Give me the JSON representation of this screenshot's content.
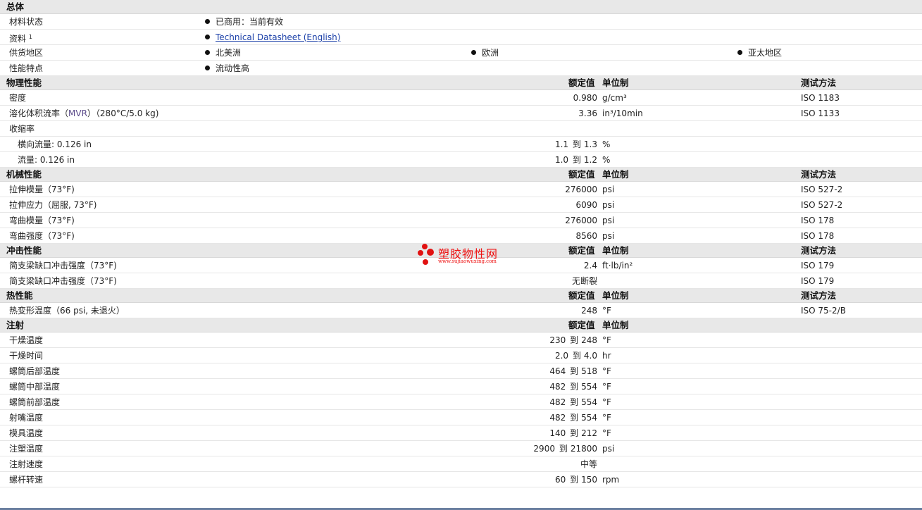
{
  "general": {
    "title": "总体",
    "rows": [
      {
        "label": "材料状态",
        "items": [
          "已商用：当前有效"
        ]
      },
      {
        "label": "资料",
        "sup": "1",
        "items": [
          "Technical Datasheet (English)"
        ],
        "link": true
      },
      {
        "label": "供货地区",
        "items": [
          "北美洲",
          "欧洲",
          "亚太地区"
        ]
      },
      {
        "label": "性能特点",
        "items": [
          "流动性高"
        ]
      }
    ]
  },
  "headers": {
    "value": "额定值",
    "unit": "单位制",
    "method": "测试方法"
  },
  "physical": {
    "title": "物理性能",
    "rows": [
      {
        "label": "密度",
        "value": "0.980",
        "unit": "g/cm³",
        "method": "ISO 1183"
      },
      {
        "label_pre": "溶化体积流率（",
        "label_mvr": "MVR",
        "label_post": "）（280°C/5.0 kg)",
        "value": "3.36",
        "unit": "in³/10min",
        "method": "ISO 1133"
      },
      {
        "label": "收缩率",
        "value": "",
        "unit": "",
        "method": ""
      },
      {
        "label": "横向流量: 0.126 in",
        "sub": true,
        "from": "1.1",
        "to": "1.3",
        "unit": "%",
        "method": ""
      },
      {
        "label": "流量: 0.126 in",
        "sub": true,
        "from": "1.0",
        "to": "1.2",
        "unit": "%",
        "method": ""
      }
    ]
  },
  "mechanical": {
    "title": "机械性能",
    "rows": [
      {
        "label": "拉伸模量（73°F)",
        "value": "276000",
        "unit": "psi",
        "method": "ISO 527-2"
      },
      {
        "label": "拉伸应力（屈服, 73°F)",
        "value": "6090",
        "unit": "psi",
        "method": "ISO 527-2"
      },
      {
        "label": "弯曲模量（73°F)",
        "value": "276000",
        "unit": "psi",
        "method": "ISO 178"
      },
      {
        "label": "弯曲强度（73°F)",
        "value": "8560",
        "unit": "psi",
        "method": "ISO 178"
      }
    ]
  },
  "impact": {
    "title": "冲击性能",
    "rows": [
      {
        "label": "简支梁缺口冲击强度（73°F)",
        "value": "2.4",
        "unit": "ft·lb/in²",
        "method": "ISO 179"
      },
      {
        "label": "简支梁缺口冲击强度（73°F)",
        "value": "无断裂",
        "unit": "",
        "method": "ISO 179"
      }
    ]
  },
  "thermal": {
    "title": "热性能",
    "rows": [
      {
        "label": "热变形温度（66 psi, 未退火）",
        "value": "248",
        "unit": "°F",
        "method": "ISO 75-2/B"
      }
    ]
  },
  "injection": {
    "title": "注射",
    "rows": [
      {
        "label": "干燥温度",
        "from": "230",
        "to": "248",
        "unit": "°F"
      },
      {
        "label": "干燥时间",
        "from": "2.0",
        "to": "4.0",
        "unit": "hr"
      },
      {
        "label": "螺筒后部温度",
        "from": "464",
        "to": "518",
        "unit": "°F"
      },
      {
        "label": "螺筒中部温度",
        "from": "482",
        "to": "554",
        "unit": "°F"
      },
      {
        "label": "螺筒前部温度",
        "from": "482",
        "to": "554",
        "unit": "°F"
      },
      {
        "label": "射嘴温度",
        "from": "482",
        "to": "554",
        "unit": "°F"
      },
      {
        "label": "模具温度",
        "from": "140",
        "to": "212",
        "unit": "°F"
      },
      {
        "label": "注塑温度",
        "from": "2900",
        "to": "21800",
        "unit": "psi"
      },
      {
        "label": "注射速度",
        "value": "中等",
        "unit": ""
      },
      {
        "label": "螺杆转速",
        "from": "60",
        "to": "150",
        "unit": "rpm"
      }
    ]
  },
  "range_word": "到",
  "watermark": {
    "text": "塑胶物性网",
    "url": "www.sujiaowuxing.com",
    "color": "#e11111"
  }
}
